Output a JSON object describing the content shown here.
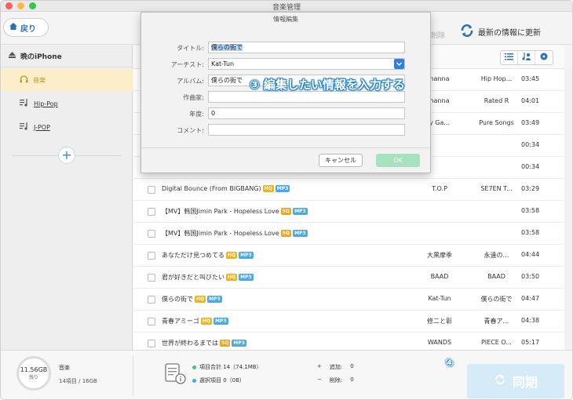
{
  "window": {
    "title": "音楽管理"
  },
  "toolbar": {
    "back_label": "戻り",
    "delete_label": "削除",
    "refresh_label": "最新の情報に更新"
  },
  "sidebar": {
    "device": "晩のiPhone",
    "items": [
      {
        "label": "音楽",
        "active": true
      },
      {
        "label": "Hip-Pop",
        "active": false
      },
      {
        "label": "J-POP",
        "active": false
      }
    ]
  },
  "list": {
    "rows": [
      {
        "title": "",
        "quality": "",
        "format": "",
        "artist": "hanna",
        "album": "Hip Hop...",
        "duration": "03:45"
      },
      {
        "title": "",
        "quality": "",
        "format": "",
        "artist": "hanna",
        "album": "Rated R",
        "duration": "04:01"
      },
      {
        "title": "",
        "quality": "",
        "format": "",
        "artist": "y Ga...",
        "album": "Pure Songs",
        "duration": "03:49"
      },
      {
        "title": "",
        "quality": "",
        "format": "",
        "artist": "",
        "album": "",
        "duration": "00:34"
      },
      {
        "title": "",
        "quality": "",
        "format": "",
        "artist": "",
        "album": "",
        "duration": "00:34"
      },
      {
        "title": "Digital Bounce (From BIGBANG)",
        "quality": "HQ",
        "format": "MP3",
        "artist": "T.O.P",
        "album": "SE7EN T...",
        "duration": "03:29"
      },
      {
        "title": "【MV】韩国Jimin Park - Hopeless Love",
        "quality": "SQ",
        "format": "MP3",
        "artist": "",
        "album": "",
        "duration": "03:58"
      },
      {
        "title": "【MV】韩国Jimin Park - Hopeless Love",
        "quality": "SQ",
        "format": "MP3",
        "artist": "",
        "album": "",
        "duration": "03:58"
      },
      {
        "title": "あなただけ見つめてる",
        "quality": "HQ",
        "format": "MP3",
        "artist": "大黒摩季",
        "album": "永遠の…",
        "duration": "04:44"
      },
      {
        "title": "君が好きだと叫びたい",
        "quality": "HQ",
        "format": "MP3",
        "artist": "BAAD",
        "album": "BAAD",
        "duration": "03:50"
      },
      {
        "title": "僕らの街で",
        "quality": "HQ",
        "format": "MP3",
        "artist": "Kat-Tun",
        "album": "僕らの街で",
        "duration": "04:47"
      },
      {
        "title": "青春アミーゴ",
        "quality": "HQ",
        "format": "MP3",
        "artist": "修二と彰",
        "album": "青春ア…",
        "duration": "04:38"
      },
      {
        "title": "世界が終わるまでは",
        "quality": "SQ",
        "format": "MP3",
        "artist": "WANDS",
        "album": "PIECE O...",
        "duration": "05:17"
      }
    ]
  },
  "footer": {
    "storage_value": "11.56GB",
    "storage_remaining": "残り",
    "category": "音楽",
    "category_count": "14項目 / 16GB",
    "total_label": "項目合計 14（74.1MB）",
    "selected_label": "選択項目 0（0B）",
    "added_label": "追加:",
    "added_value": "0",
    "deleted_label": "削除:",
    "deleted_value": "0",
    "sync_label": "同期"
  },
  "dialog": {
    "title": "情報編集",
    "fields": {
      "title_label": "タイトル:",
      "title_value": "僕らの街で",
      "artist_label": "アーチスト:",
      "artist_value": "Kat-Tun",
      "album_label": "アルバム:",
      "album_value": "僕らの街で",
      "composer_label": "作曲家:",
      "composer_value": "",
      "year_label": "年度:",
      "year_value": "0",
      "comment_label": "コメント:",
      "comment_value": ""
    },
    "cancel_label": "キャンセル",
    "ok_label": "OK"
  },
  "annotations": {
    "step3": "③ 編集したい情報を入力する",
    "step4": "④"
  },
  "colors": {
    "accent_blue": "#2d6fb4",
    "active_item_bg": "#fbeec8",
    "active_item_text": "#c9931b",
    "hq_badge": "#f3b11c",
    "format_badge": "#4aa9e9",
    "ok_button": "#a7e2bf",
    "sync_button": "#d5ebf8"
  }
}
